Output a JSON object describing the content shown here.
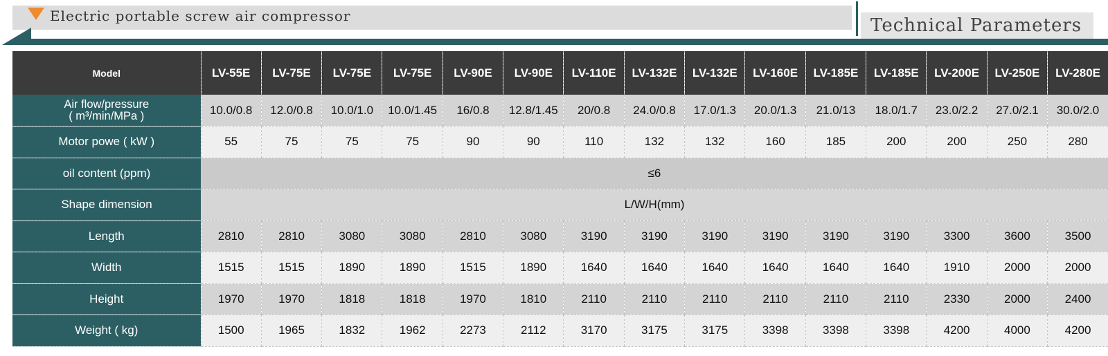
{
  "header": {
    "title": "Electric portable screw air compressor",
    "section": "Technical Parameters"
  },
  "colors": {
    "accent_teal": "#2c5f63",
    "header_dark": "#3b3b3b",
    "marker_orange": "#f08a2e"
  },
  "table": {
    "model_label": "Model",
    "models": [
      "LV-55E",
      "LV-75E",
      "LV-75E",
      "LV-75E",
      "LV-90E",
      "LV-90E",
      "LV-110E",
      "LV-132E",
      "LV-132E",
      "LV-160E",
      "LV-185E",
      "LV-185E",
      "LV-200E",
      "LV-250E",
      "LV-280E"
    ],
    "airflow_label_1": "Air flow/pressure",
    "airflow_label_2": "( m³/min/MPa )",
    "airflow": [
      "10.0/0.8",
      "12.0/0.8",
      "10.0/1.0",
      "10.0/1.45",
      "16/0.8",
      "12.8/1.45",
      "20/0.8",
      "24.0/0.8",
      "17.0/1.3",
      "20.0/1.3",
      "21.0/13",
      "18.0/1.7",
      "23.0/2.2",
      "27.0/2.1",
      "30.0/2.0"
    ],
    "motor_label": "Motor powe ( kW )",
    "motor": [
      "55",
      "75",
      "75",
      "75",
      "90",
      "90",
      "110",
      "132",
      "132",
      "160",
      "185",
      "200",
      "200",
      "250",
      "280"
    ],
    "oil_label": "oil content (ppm)",
    "oil_value": "≤6",
    "shape_label": "Shape dimension",
    "shape_value": "L/W/H(mm)",
    "length_label": "Length",
    "length": [
      "2810",
      "2810",
      "3080",
      "3080",
      "2810",
      "3080",
      "3190",
      "3190",
      "3190",
      "3190",
      "3190",
      "3190",
      "3300",
      "3600",
      "3500"
    ],
    "width_label": "Width",
    "width": [
      "1515",
      "1515",
      "1890",
      "1890",
      "1515",
      "1890",
      "1640",
      "1640",
      "1640",
      "1640",
      "1640",
      "1640",
      "1910",
      "2000",
      "2000"
    ],
    "height_label": "Height",
    "height": [
      "1970",
      "1970",
      "1818",
      "1818",
      "1970",
      "1810",
      "2110",
      "2110",
      "2110",
      "2110",
      "2110",
      "2110",
      "2330",
      "2000",
      "2400"
    ],
    "weight_label": "Weight ( kg)",
    "weight": [
      "1500",
      "1965",
      "1832",
      "1962",
      "2273",
      "2112",
      "3170",
      "3175",
      "3175",
      "3398",
      "3398",
      "3398",
      "4200",
      "4000",
      "4200"
    ]
  }
}
